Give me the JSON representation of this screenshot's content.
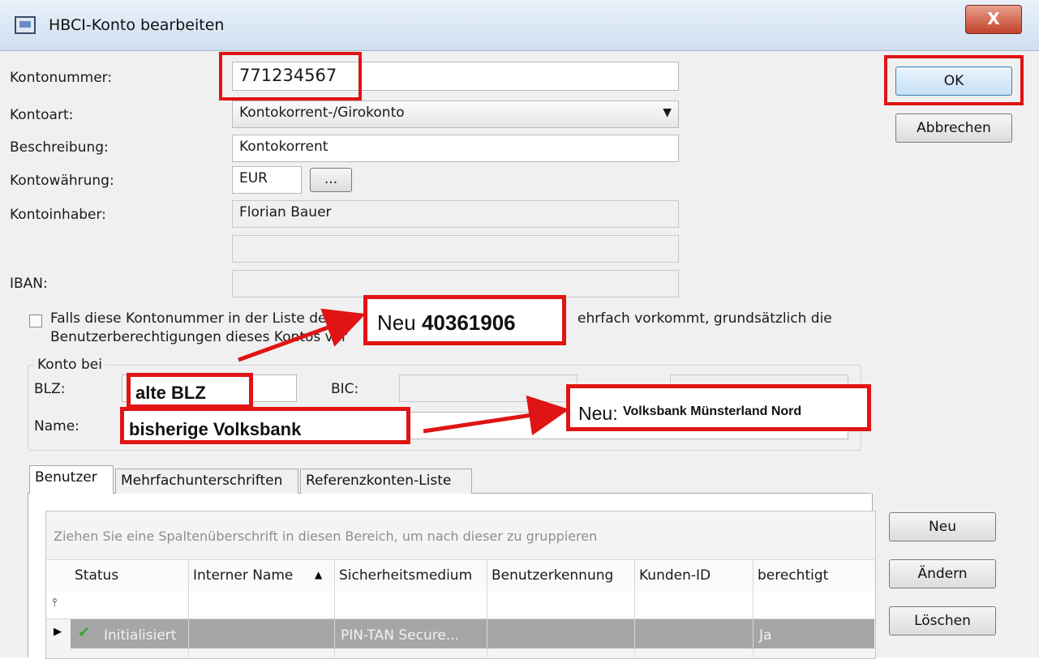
{
  "window": {
    "title": "HBCI-Konto bearbeiten",
    "close_label": "X"
  },
  "form": {
    "kontonummer_label": "Kontonummer:",
    "kontonummer_value": "771234567",
    "kontoart_label": "Kontoart:",
    "kontoart_value": "Kontokorrent-/Girokonto",
    "beschreibung_label": "Beschreibung:",
    "beschreibung_value": "Kontokorrent",
    "waehrung_label": "Kontowährung:",
    "waehrung_value": "EUR",
    "waehrung_button": "...",
    "inhaber_label": "Kontoinhaber:",
    "inhaber_value": "Florian Bauer",
    "iban_label": "IBAN:",
    "checkbox_text_1": "Falls diese Kontonummer in der Liste der HB",
    "checkbox_text_1b": "ehrfach vorkommt, grundsätzlich die",
    "checkbox_text_2": "Benutzerberechtigungen dieses Kontos ver"
  },
  "konto_bei": {
    "group_label": "Konto bei",
    "blz_label": "BLZ:",
    "bic_label": "BIC:",
    "name_label": "Name:"
  },
  "buttons": {
    "ok": "OK",
    "cancel": "Abbrechen",
    "new": "Neu",
    "change": "Ändern",
    "delete": "Löschen"
  },
  "tabs": [
    "Benutzer",
    "Mehrfachunterschriften",
    "Referenzkonten-Liste"
  ],
  "grid": {
    "group_hint": "Ziehen Sie eine Spaltenüberschrift in diesen Bereich, um nach dieser zu gruppieren",
    "columns": [
      "Status",
      "Interner Name",
      "Sicherheitsmedium",
      "Benutzerkennung",
      "Kunden-ID",
      "berechtigt"
    ],
    "sort_indicator": "▲",
    "filter_glyph": "⫯",
    "row": {
      "status": "Initialisiert",
      "medium": "PIN-TAN Secure...",
      "berechtigt": "Ja"
    }
  },
  "annotations": {
    "neu_blz_prefix": "Neu",
    "neu_blz_value": "40361906",
    "alte_blz": "alte BLZ",
    "bisherige_bank": "bisherige Volksbank",
    "neu_bank_prefix": "Neu:",
    "neu_bank_value": "Volksbank Münsterland Nord"
  },
  "colors": {
    "annotation_red": "#e01414",
    "selection_gray": "#a6a6a6"
  }
}
